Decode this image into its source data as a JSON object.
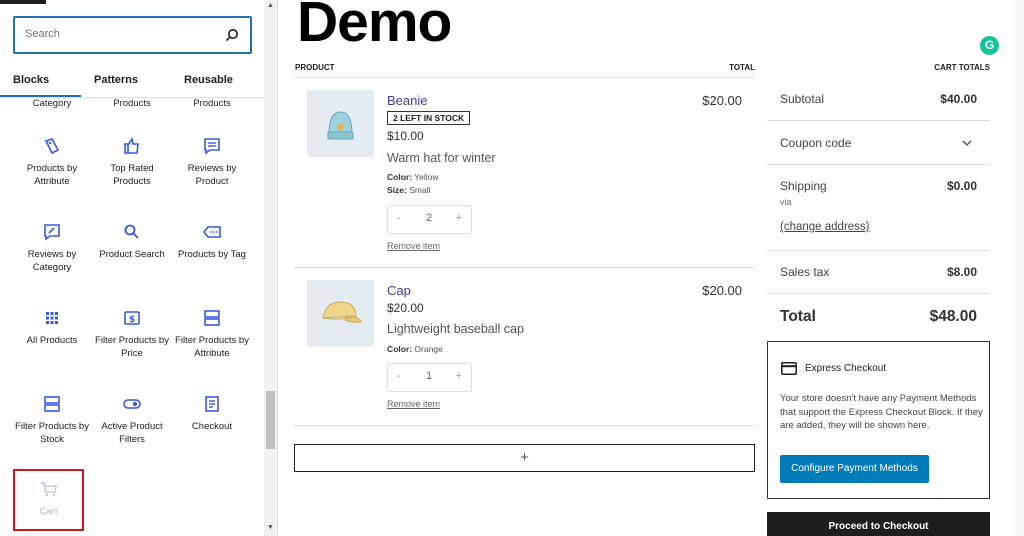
{
  "inserter": {
    "search_placeholder": "Search",
    "tabs": [
      "Blocks",
      "Patterns",
      "Reusable"
    ],
    "cut_labels": [
      "Category",
      "Products",
      "Products"
    ],
    "blocks": [
      {
        "label": "Products by Attribute",
        "icon": "tag-icon"
      },
      {
        "label": "Top Rated Products",
        "icon": "thumbs-up-icon"
      },
      {
        "label": "Reviews by Product",
        "icon": "comment-icon"
      },
      {
        "label": "Reviews by Category",
        "icon": "review-edit-icon"
      },
      {
        "label": "Product Search",
        "icon": "search-icon"
      },
      {
        "label": "Products by Tag",
        "icon": "tag-label-icon"
      },
      {
        "label": "All Products",
        "icon": "grid-icon"
      },
      {
        "label": "Filter Products by Price",
        "icon": "dollar-icon"
      },
      {
        "label": "Filter Products by Attribute",
        "icon": "filter-icon"
      },
      {
        "label": "Filter Products by Stock",
        "icon": "stock-filter-icon"
      },
      {
        "label": "Active Product Filters",
        "icon": "toggle-icon"
      },
      {
        "label": "Checkout",
        "icon": "checkout-icon"
      }
    ],
    "cart_block": {
      "label": "Cart",
      "icon": "cart-icon"
    }
  },
  "page": {
    "title": "Demo"
  },
  "cart": {
    "header": {
      "product": "PRODUCT",
      "total": "TOTAL"
    },
    "items": [
      {
        "name": "Beanie",
        "badge": "2 LEFT IN STOCK",
        "price": "$10.00",
        "description": "Warm hat for winter",
        "meta": [
          {
            "key": "Color:",
            "value": "Yellow"
          },
          {
            "key": "Size:",
            "value": "Small"
          }
        ],
        "qty_minus": "-",
        "qty": "2",
        "qty_plus": "+",
        "remove": "Remove item",
        "total": "$20.00"
      },
      {
        "name": "Cap",
        "price": "$20.00",
        "description": "Lightweight baseball cap",
        "meta": [
          {
            "key": "Color:",
            "value": "Orange"
          }
        ],
        "qty_minus": "-",
        "qty": "1",
        "qty_plus": "+",
        "remove": "Remove item",
        "total": "$20.00"
      }
    ],
    "add_block": "+"
  },
  "totals": {
    "header": "CART TOTALS",
    "subtotal_label": "Subtotal",
    "subtotal_value": "$40.00",
    "coupon_label": "Coupon code",
    "shipping_label": "Shipping",
    "shipping_value": "$0.00",
    "shipping_via": "via",
    "change_address": "(change address)",
    "tax_label": "Sales tax",
    "tax_value": "$8.00",
    "total_label": "Total",
    "total_value": "$48.00"
  },
  "express": {
    "title": "Express Checkout",
    "text": "Your store doesn't have any Payment Methods that support the Express Checkout Block. If they are added, they will be shown here.",
    "configure_button": "Configure Payment Methods"
  },
  "checkout_button": "Proceed to Checkout",
  "grammarly_letter": "G",
  "colors": {
    "accent": "#2271b1",
    "icon": "#3858e9",
    "cart_highlight": "#cc1818",
    "button_blue": "#007cba"
  }
}
